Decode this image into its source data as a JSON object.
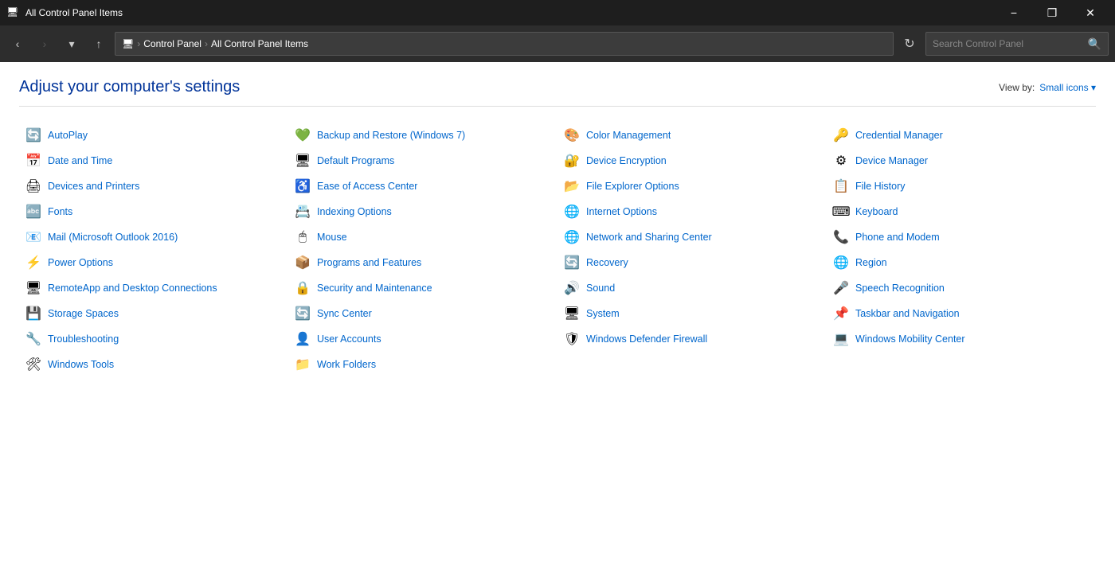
{
  "titleBar": {
    "title": "All Control Panel Items",
    "iconUnicode": "🖥",
    "minimizeLabel": "−",
    "restoreLabel": "❐",
    "closeLabel": "✕"
  },
  "addressBar": {
    "backLabel": "‹",
    "forwardLabel": "›",
    "upLabel": "↑",
    "dropdownLabel": "▾",
    "pathParts": [
      "Control Panel",
      "All Control Panel Items"
    ],
    "refreshLabel": "↻",
    "searchPlaceholder": "Search Control Panel",
    "searchIconLabel": "🔍"
  },
  "header": {
    "title": "Adjust your computer's settings",
    "viewByLabel": "View by:",
    "viewByValue": "Small icons",
    "viewByDropdown": "▾"
  },
  "items": [
    {
      "icon": "🔄",
      "label": "AutoPlay",
      "color": "#4a7c59"
    },
    {
      "icon": "📅",
      "label": "Date and Time",
      "color": "#3b6ea5"
    },
    {
      "icon": "🖨",
      "label": "Devices and Printers",
      "color": "#555"
    },
    {
      "icon": "🔤",
      "label": "Fonts",
      "color": "#e6b800"
    },
    {
      "icon": "📧",
      "label": "Mail (Microsoft Outlook 2016)",
      "color": "#1e6bbf"
    },
    {
      "icon": "⚡",
      "label": "Power Options",
      "color": "#4a7c59"
    },
    {
      "icon": "🖥",
      "label": "RemoteApp and Desktop Connections",
      "color": "#1e6bbf"
    },
    {
      "icon": "💾",
      "label": "Storage Spaces",
      "color": "#555"
    },
    {
      "icon": "🔧",
      "label": "Troubleshooting",
      "color": "#1e6bbf"
    },
    {
      "icon": "🛠",
      "label": "Windows Tools",
      "color": "#555"
    },
    {
      "icon": "💚",
      "label": "Backup and Restore (Windows 7)",
      "color": "#4a7c59"
    },
    {
      "icon": "🖥",
      "label": "Default Programs",
      "color": "#1e6bbf"
    },
    {
      "icon": "♿",
      "label": "Ease of Access Center",
      "color": "#1e6bbf"
    },
    {
      "icon": "📇",
      "label": "Indexing Options",
      "color": "#1e6bbf"
    },
    {
      "icon": "🖱",
      "label": "Mouse",
      "color": "#555"
    },
    {
      "icon": "📦",
      "label": "Programs and Features",
      "color": "#1e6bbf"
    },
    {
      "icon": "🔒",
      "label": "Security and Maintenance",
      "color": "#1e6bbf"
    },
    {
      "icon": "🔄",
      "label": "Sync Center",
      "color": "#4a7c59"
    },
    {
      "icon": "👤",
      "label": "User Accounts",
      "color": "#1e6bbf"
    },
    {
      "icon": "📁",
      "label": "Work Folders",
      "color": "#e6b800"
    },
    {
      "icon": "🎨",
      "label": "Color Management",
      "color": "#1e6bbf"
    },
    {
      "icon": "🔐",
      "label": "Device Encryption",
      "color": "#555"
    },
    {
      "icon": "📂",
      "label": "File Explorer Options",
      "color": "#e6b800"
    },
    {
      "icon": "🌐",
      "label": "Internet Options",
      "color": "#1e6bbf"
    },
    {
      "icon": "🌐",
      "label": "Network and Sharing Center",
      "color": "#1e6bbf"
    },
    {
      "icon": "🔄",
      "label": "Recovery",
      "color": "#1e6bbf"
    },
    {
      "icon": "🔊",
      "label": "Sound",
      "color": "#555"
    },
    {
      "icon": "🖥",
      "label": "System",
      "color": "#1e6bbf"
    },
    {
      "icon": "🛡",
      "label": "Windows Defender Firewall",
      "color": "#cc0000"
    },
    {
      "icon": "🔑",
      "label": "Credential Manager",
      "color": "#555"
    },
    {
      "icon": "⚙",
      "label": "Device Manager",
      "color": "#555"
    },
    {
      "icon": "📋",
      "label": "File History",
      "color": "#e6b800"
    },
    {
      "icon": "⌨",
      "label": "Keyboard",
      "color": "#555"
    },
    {
      "icon": "📞",
      "label": "Phone and Modem",
      "color": "#555"
    },
    {
      "icon": "🌐",
      "label": "Region",
      "color": "#1e6bbf"
    },
    {
      "icon": "🎤",
      "label": "Speech Recognition",
      "color": "#555"
    },
    {
      "icon": "📌",
      "label": "Taskbar and Navigation",
      "color": "#1e6bbf"
    },
    {
      "icon": "💻",
      "label": "Windows Mobility Center",
      "color": "#1e6bbf"
    }
  ]
}
